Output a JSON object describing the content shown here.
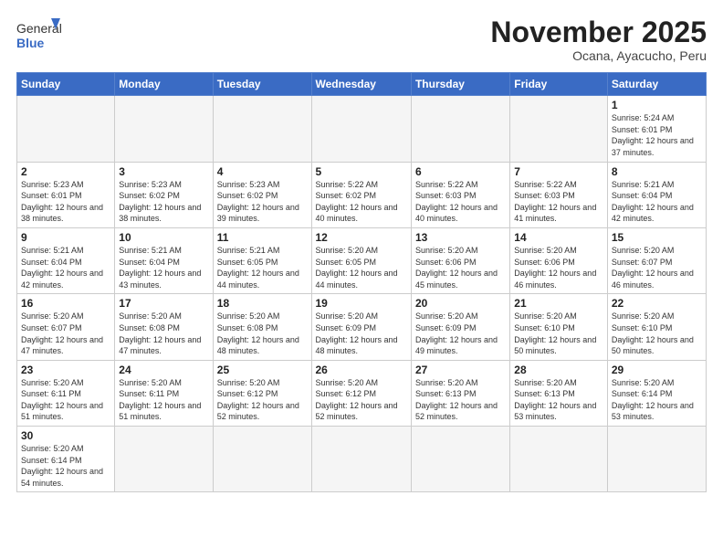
{
  "logo": {
    "text_general": "General",
    "text_blue": "Blue"
  },
  "header": {
    "month_title": "November 2025",
    "subtitle": "Ocana, Ayacucho, Peru"
  },
  "days_of_week": [
    "Sunday",
    "Monday",
    "Tuesday",
    "Wednesday",
    "Thursday",
    "Friday",
    "Saturday"
  ],
  "weeks": [
    [
      {
        "day": "",
        "info": ""
      },
      {
        "day": "",
        "info": ""
      },
      {
        "day": "",
        "info": ""
      },
      {
        "day": "",
        "info": ""
      },
      {
        "day": "",
        "info": ""
      },
      {
        "day": "",
        "info": ""
      },
      {
        "day": "1",
        "info": "Sunrise: 5:24 AM\nSunset: 6:01 PM\nDaylight: 12 hours and 37 minutes."
      }
    ],
    [
      {
        "day": "2",
        "info": "Sunrise: 5:23 AM\nSunset: 6:01 PM\nDaylight: 12 hours and 38 minutes."
      },
      {
        "day": "3",
        "info": "Sunrise: 5:23 AM\nSunset: 6:02 PM\nDaylight: 12 hours and 38 minutes."
      },
      {
        "day": "4",
        "info": "Sunrise: 5:23 AM\nSunset: 6:02 PM\nDaylight: 12 hours and 39 minutes."
      },
      {
        "day": "5",
        "info": "Sunrise: 5:22 AM\nSunset: 6:02 PM\nDaylight: 12 hours and 40 minutes."
      },
      {
        "day": "6",
        "info": "Sunrise: 5:22 AM\nSunset: 6:03 PM\nDaylight: 12 hours and 40 minutes."
      },
      {
        "day": "7",
        "info": "Sunrise: 5:22 AM\nSunset: 6:03 PM\nDaylight: 12 hours and 41 minutes."
      },
      {
        "day": "8",
        "info": "Sunrise: 5:21 AM\nSunset: 6:04 PM\nDaylight: 12 hours and 42 minutes."
      }
    ],
    [
      {
        "day": "9",
        "info": "Sunrise: 5:21 AM\nSunset: 6:04 PM\nDaylight: 12 hours and 42 minutes."
      },
      {
        "day": "10",
        "info": "Sunrise: 5:21 AM\nSunset: 6:04 PM\nDaylight: 12 hours and 43 minutes."
      },
      {
        "day": "11",
        "info": "Sunrise: 5:21 AM\nSunset: 6:05 PM\nDaylight: 12 hours and 44 minutes."
      },
      {
        "day": "12",
        "info": "Sunrise: 5:20 AM\nSunset: 6:05 PM\nDaylight: 12 hours and 44 minutes."
      },
      {
        "day": "13",
        "info": "Sunrise: 5:20 AM\nSunset: 6:06 PM\nDaylight: 12 hours and 45 minutes."
      },
      {
        "day": "14",
        "info": "Sunrise: 5:20 AM\nSunset: 6:06 PM\nDaylight: 12 hours and 46 minutes."
      },
      {
        "day": "15",
        "info": "Sunrise: 5:20 AM\nSunset: 6:07 PM\nDaylight: 12 hours and 46 minutes."
      }
    ],
    [
      {
        "day": "16",
        "info": "Sunrise: 5:20 AM\nSunset: 6:07 PM\nDaylight: 12 hours and 47 minutes."
      },
      {
        "day": "17",
        "info": "Sunrise: 5:20 AM\nSunset: 6:08 PM\nDaylight: 12 hours and 47 minutes."
      },
      {
        "day": "18",
        "info": "Sunrise: 5:20 AM\nSunset: 6:08 PM\nDaylight: 12 hours and 48 minutes."
      },
      {
        "day": "19",
        "info": "Sunrise: 5:20 AM\nSunset: 6:09 PM\nDaylight: 12 hours and 48 minutes."
      },
      {
        "day": "20",
        "info": "Sunrise: 5:20 AM\nSunset: 6:09 PM\nDaylight: 12 hours and 49 minutes."
      },
      {
        "day": "21",
        "info": "Sunrise: 5:20 AM\nSunset: 6:10 PM\nDaylight: 12 hours and 50 minutes."
      },
      {
        "day": "22",
        "info": "Sunrise: 5:20 AM\nSunset: 6:10 PM\nDaylight: 12 hours and 50 minutes."
      }
    ],
    [
      {
        "day": "23",
        "info": "Sunrise: 5:20 AM\nSunset: 6:11 PM\nDaylight: 12 hours and 51 minutes."
      },
      {
        "day": "24",
        "info": "Sunrise: 5:20 AM\nSunset: 6:11 PM\nDaylight: 12 hours and 51 minutes."
      },
      {
        "day": "25",
        "info": "Sunrise: 5:20 AM\nSunset: 6:12 PM\nDaylight: 12 hours and 52 minutes."
      },
      {
        "day": "26",
        "info": "Sunrise: 5:20 AM\nSunset: 6:12 PM\nDaylight: 12 hours and 52 minutes."
      },
      {
        "day": "27",
        "info": "Sunrise: 5:20 AM\nSunset: 6:13 PM\nDaylight: 12 hours and 52 minutes."
      },
      {
        "day": "28",
        "info": "Sunrise: 5:20 AM\nSunset: 6:13 PM\nDaylight: 12 hours and 53 minutes."
      },
      {
        "day": "29",
        "info": "Sunrise: 5:20 AM\nSunset: 6:14 PM\nDaylight: 12 hours and 53 minutes."
      }
    ],
    [
      {
        "day": "30",
        "info": "Sunrise: 5:20 AM\nSunset: 6:14 PM\nDaylight: 12 hours and 54 minutes."
      },
      {
        "day": "",
        "info": ""
      },
      {
        "day": "",
        "info": ""
      },
      {
        "day": "",
        "info": ""
      },
      {
        "day": "",
        "info": ""
      },
      {
        "day": "",
        "info": ""
      },
      {
        "day": "",
        "info": ""
      }
    ]
  ]
}
